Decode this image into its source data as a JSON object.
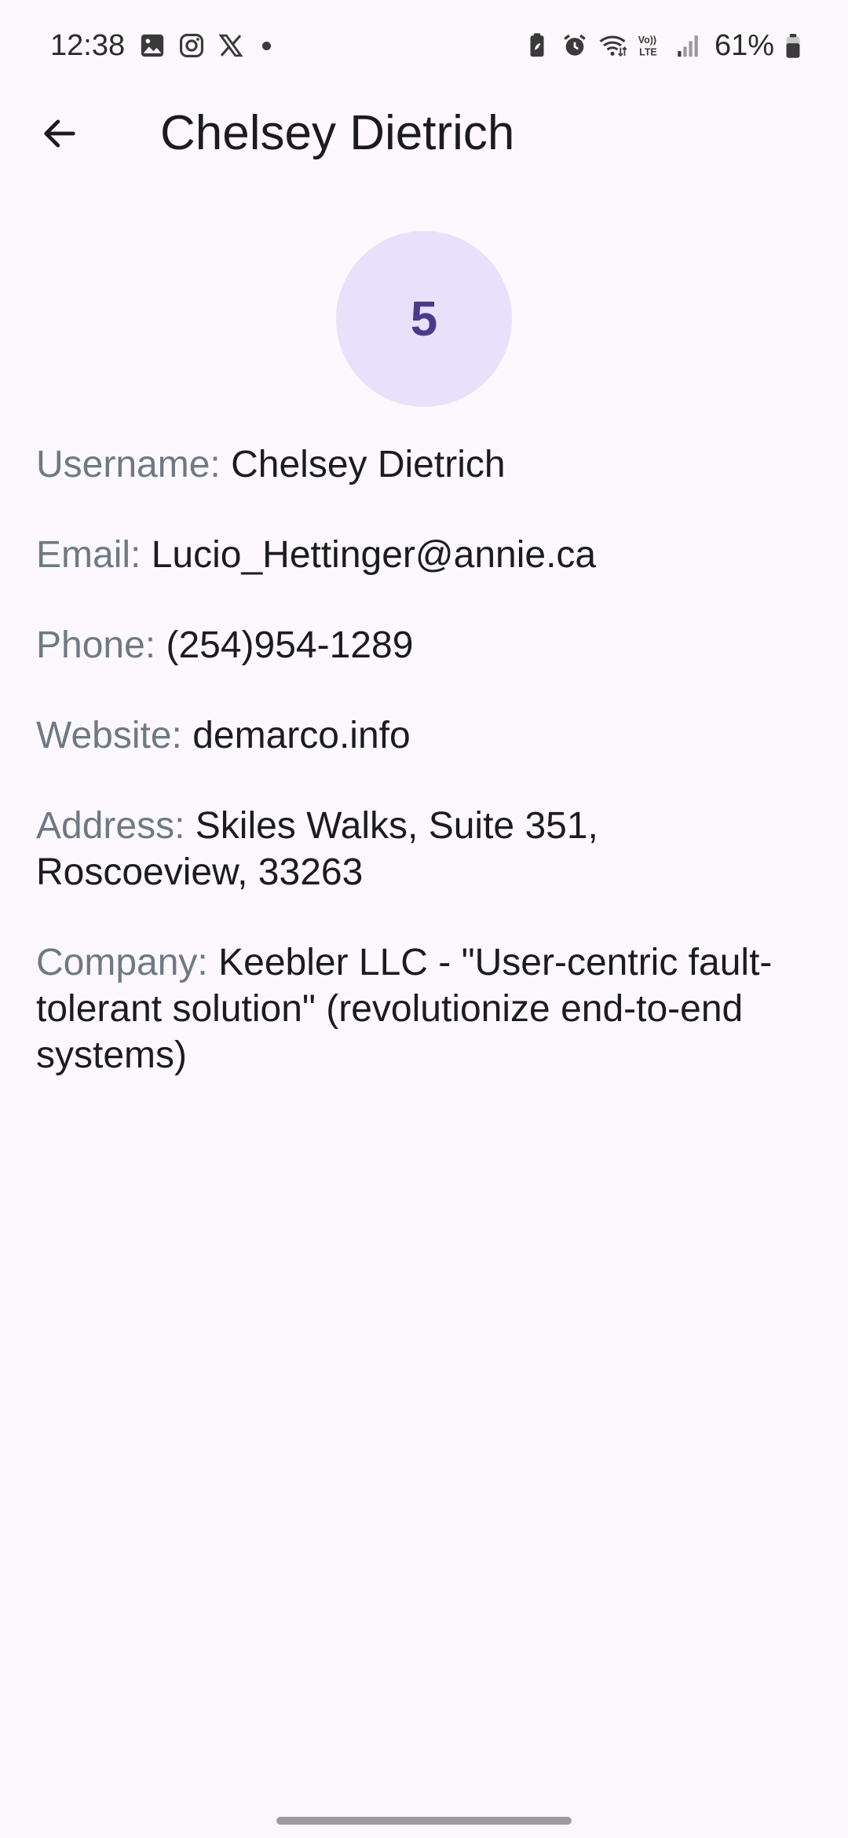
{
  "status_bar": {
    "time": "12:38",
    "left_icons": [
      "gallery-icon",
      "instagram-icon",
      "x-icon"
    ],
    "right_icons": [
      "battery-saver-icon",
      "alarm-icon",
      "wifi-icon",
      "volte-icon",
      "signal-icon",
      "battery-icon"
    ],
    "battery": "61%"
  },
  "app_bar": {
    "title": "Chelsey Dietrich",
    "back_icon": "arrow-back-icon"
  },
  "avatar": {
    "text": "5",
    "background": "#e9e0fb",
    "text_color": "#4a3a8a"
  },
  "details": {
    "username": {
      "label": "Username:",
      "value": "Chelsey Dietrich"
    },
    "email": {
      "label": "Email:",
      "value": "Lucio_Hettinger@annie.ca"
    },
    "phone": {
      "label": "Phone:",
      "value": "(254)954-1289"
    },
    "website": {
      "label": "Website:",
      "value": "demarco.info"
    },
    "address": {
      "label": "Address:",
      "value": "Skiles Walks, Suite 351, Roscoeview, 33263"
    },
    "company": {
      "label": "Company:",
      "value": "Keebler LLC - \"User-centric fault-tolerant solution\" (revolutionize end-to-end systems)"
    }
  },
  "colors": {
    "background": "#fdf8fd",
    "label": "#6d7a83",
    "text": "#1c1b1f"
  }
}
